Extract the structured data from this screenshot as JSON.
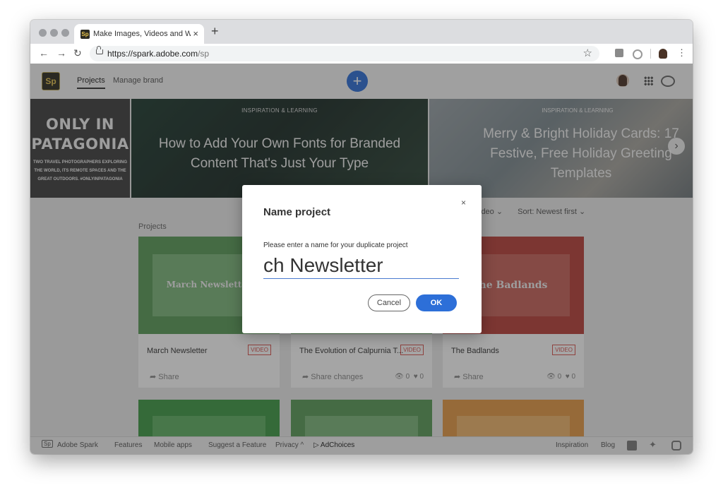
{
  "browser": {
    "tab_title": "Make Images, Videos and Web Stories",
    "tab_close": "×",
    "new_tab": "+",
    "url_host": "https://spark.adobe.com",
    "url_path": "/sp"
  },
  "app": {
    "logo": "Sp",
    "nav": {
      "projects": "Projects",
      "manage_brand": "Manage brand"
    },
    "create": "+"
  },
  "banners": [
    {
      "title": "ONLY IN PATAGONIA",
      "text": "TWO TRAVEL PHOTOGRAPHERS EXPLORING THE WORLD, ITS REMOTE SPACES AND THE GREAT OUTDOORS. #ONLYINPATAGONIA"
    },
    {
      "kicker": "INSPIRATION & LEARNING",
      "title": "How to Add Your Own Fonts for Branded Content That's Just Your Type"
    },
    {
      "kicker": "INSPIRATION & LEARNING",
      "title": "Merry & Bright Holiday Cards: 17 Festive, Free Holiday Greeting Templates"
    }
  ],
  "content": {
    "section_label": "Projects",
    "filter": "ideo",
    "sort": "Sort: Newest first"
  },
  "cards": [
    {
      "thumb_text": "March Newsletter",
      "title": "March Newsletter",
      "badge": "VIDEO",
      "share": "Share",
      "views": "",
      "likes": ""
    },
    {
      "thumb_text": "",
      "title": "The Evolution of Calpurnia T...",
      "badge": "VIDEO",
      "share": "Share changes",
      "views": "0",
      "likes": "0"
    },
    {
      "thumb_text": "he Badlands",
      "title": "The Badlands",
      "badge": "VIDEO",
      "share": "Share",
      "views": "0",
      "likes": "0"
    }
  ],
  "footer": {
    "brand": "Adobe Spark",
    "features": "Features",
    "mobile_apps": "Mobile apps",
    "suggest": "Suggest a Feature",
    "privacy": "Privacy ^",
    "adchoices": "AdChoices",
    "inspiration": "Inspiration",
    "blog": "Blog"
  },
  "modal": {
    "title": "Name project",
    "close": "×",
    "label": "Please enter a name for your duplicate project",
    "input_value": "ch Newsletter (Spanish)",
    "cancel": "Cancel",
    "ok": "OK"
  },
  "colors": {
    "accent": "#2d6fd8",
    "card_green": "#5b9b58",
    "card_red": "#b8403a",
    "card_orange": "#e59a45",
    "video_badge": "#d9534f"
  }
}
